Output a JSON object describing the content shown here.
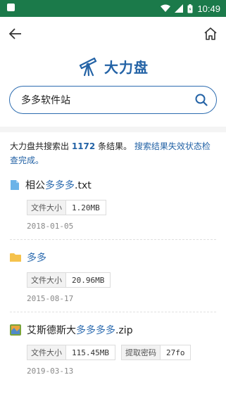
{
  "status_bar": {
    "time": "10:49"
  },
  "logo": {
    "text": "大力盘"
  },
  "search": {
    "value": "多多软件站"
  },
  "summary": {
    "prefix": "大力盘共搜索出",
    "count": "1172",
    "suffix": "条结果。",
    "link": "搜索结果失效状态检查完成。"
  },
  "results": [
    {
      "title_plain": "相公",
      "title_highlight": "多多多",
      "title_ext": ".txt",
      "icon": "document-icon",
      "meta": [
        {
          "key": "文件大小",
          "value": "1.20MB"
        }
      ],
      "date": "2018-01-05"
    },
    {
      "title_plain": "",
      "title_highlight": "多多",
      "title_ext": "",
      "icon": "folder-icon",
      "meta": [
        {
          "key": "文件大小",
          "value": "20.96MB"
        }
      ],
      "date": "2015-08-17"
    },
    {
      "title_plain": "艾斯德斯大",
      "title_highlight": "多多多多",
      "title_ext": ".zip",
      "icon": "archive-icon",
      "meta": [
        {
          "key": "文件大小",
          "value": "115.45MB"
        },
        {
          "key": "提取密码",
          "value": "27fo"
        }
      ],
      "date": "2019-03-13"
    }
  ],
  "colors": {
    "status_bar": "#1b7a4a",
    "accent": "#2463a6",
    "highlight": "#2d6cb0"
  }
}
